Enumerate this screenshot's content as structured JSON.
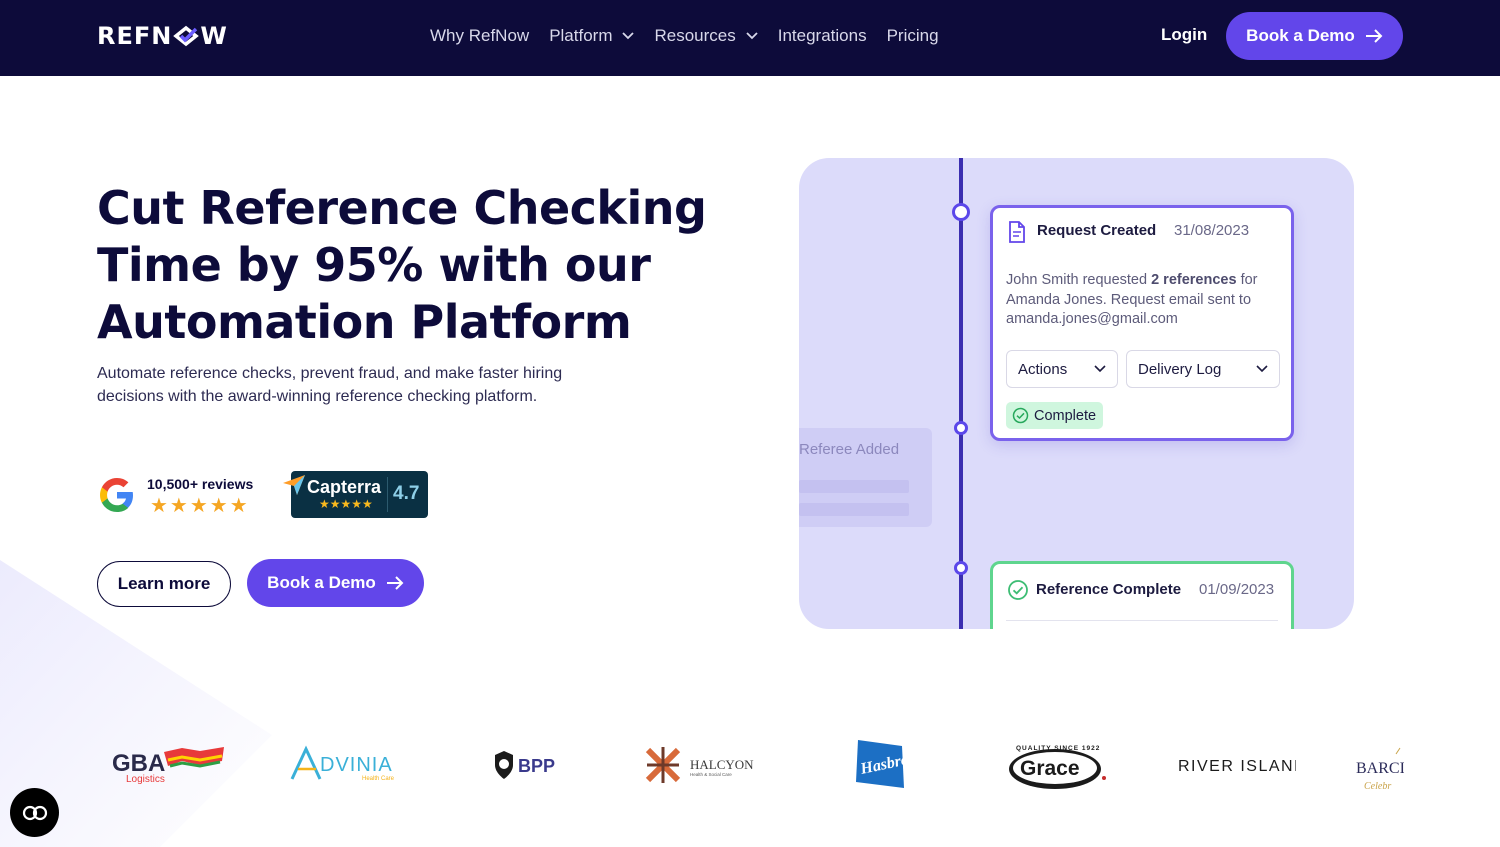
{
  "nav": {
    "brand": "REFNOW",
    "links": [
      {
        "label": "Why RefNow",
        "dropdown": false
      },
      {
        "label": "Platform",
        "dropdown": true
      },
      {
        "label": "Resources",
        "dropdown": true
      },
      {
        "label": "Integrations",
        "dropdown": false
      },
      {
        "label": "Pricing",
        "dropdown": false
      }
    ],
    "login": "Login",
    "cta": "Book a Demo"
  },
  "hero": {
    "title": "Cut Reference Checking Time by 95% with our Automation Platform",
    "subtitle": "Automate reference checks, prevent fraud, and make faster hiring decisions with the award-winning reference checking platform.",
    "google": {
      "reviews": "10,500+ reviews",
      "stars": "★★★★★"
    },
    "capterra": {
      "name": "Capterra",
      "score": "4.7",
      "stars": "★★★★★"
    },
    "learn_more": "Learn more",
    "book_demo": "Book a Demo"
  },
  "timeline": {
    "ghost_label": "Referee Added",
    "card1": {
      "title": "Request Created",
      "date": "31/08/2023",
      "body_pre": "John Smith requested ",
      "body_bold": "2 references",
      "body_post": " for Amanda Jones. Request email sent to amanda.jones@gmail.com",
      "select_actions": "Actions",
      "select_log": "Delivery Log",
      "status": "Complete"
    },
    "card2": {
      "title": "Reference Complete",
      "date": "01/09/2023"
    }
  },
  "logos": [
    "GBA Logistics",
    "ADVINIA Health Care",
    "BPP",
    "HALCYON Health & Social Care",
    "Hasbro",
    "Grace",
    "RIVER ISLAND",
    "BARCROFT Celebrating"
  ],
  "logo_texts": {
    "gba": "GBA",
    "gba_sub": "Logistics",
    "advinia": "DVINIA",
    "advinia_sub": "Health Care",
    "bpp": "BPP",
    "halcyon": "HALCYON",
    "halcyon_sub": "Health & Social Care",
    "hasbro": "Hasbro",
    "grace": "Grace",
    "grace_top": "QUALITY SINCE 1922",
    "river": "RIVER ISLAND",
    "barc": "BARCI",
    "barc_sub": "Celebr"
  },
  "colors": {
    "nav_bg": "#0d0b3a",
    "accent": "#6246ea",
    "panel_bg": "#dcdbfa",
    "complete_badge": "#cff6de"
  }
}
